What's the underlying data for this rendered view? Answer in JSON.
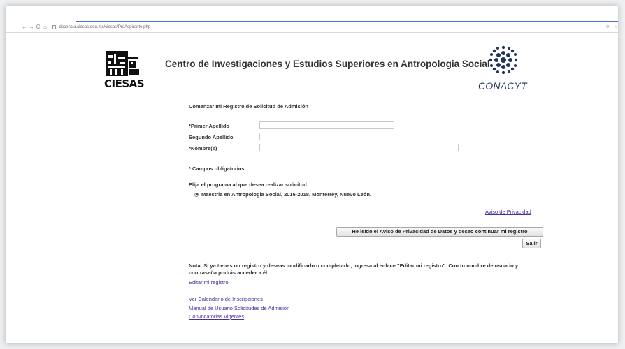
{
  "browser": {
    "url": "docencia.ciesas.edu.mx/ciesas/PreAspirante.php",
    "back_icon": "arrow-left-icon",
    "forward_icon": "arrow-right-icon",
    "reload_icon": "reload-icon",
    "home_icon": "home-icon"
  },
  "header": {
    "logo_left_text": "CIESAS",
    "title": "Centro de Investigaciones y Estudios Superiores en Antropologia Social",
    "logo_right_text": "CONACYT"
  },
  "form": {
    "heading": "Comenzar mi Registro de Solicitud de Admisión",
    "fields": [
      {
        "label": "*Primer Apellido",
        "value": ""
      },
      {
        "label": "Segundo Apellido",
        "value": ""
      },
      {
        "label": "*Nombre(s)",
        "value": ""
      }
    ],
    "required_note": "* Campos obligatorios",
    "program_prompt": "Elija el programa al que desea realizar solicitud",
    "program_option": "Maestria en Antropologia Social, 2016-2018, Monterrey, Nuevo León.",
    "program_selected": true,
    "privacy_link": "Aviso de Privacidad",
    "continue_button": "He leído el Aviso de Privacidad de Datos y deseo continuar mi registro",
    "exit_button": "Salir"
  },
  "footer": {
    "note": "Nota: Si ya tienes un registro y deseas modificarlo o completarlo, ingresa al enlace \"Editar mi registro\". Con tu nombre de usuario y contraseña podrás acceder a él.",
    "edit_link": "Editar mi registro",
    "links": [
      "Ver Calendario de Inscripciones",
      "Manual de Usuario Solicitudes de Admisión",
      "Convocatorias Vigentes"
    ]
  },
  "colors": {
    "link": "#4b2f9a",
    "conacyt_blue": "#22335e",
    "tab_accent": "#4a6fcf"
  }
}
